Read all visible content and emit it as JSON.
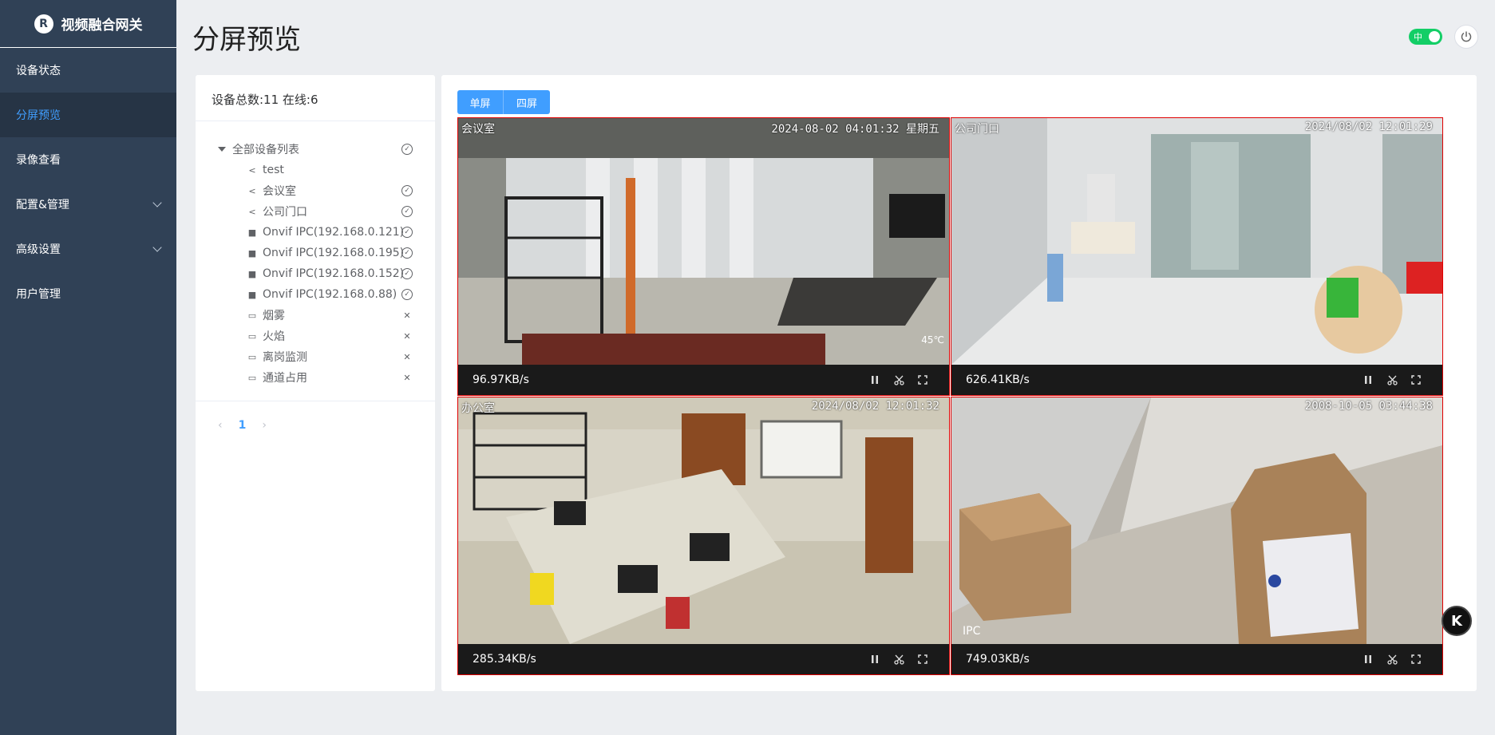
{
  "app": {
    "title": "视频融合网关",
    "logo_glyph": "R"
  },
  "sidebar": {
    "items": [
      {
        "label": "设备状态",
        "active": false,
        "expandable": false
      },
      {
        "label": "分屏预览",
        "active": true,
        "expandable": false
      },
      {
        "label": "录像查看",
        "active": false,
        "expandable": false
      },
      {
        "label": "配置&管理",
        "active": false,
        "expandable": true
      },
      {
        "label": "高级设置",
        "active": false,
        "expandable": true
      },
      {
        "label": "用户管理",
        "active": false,
        "expandable": false
      }
    ]
  },
  "header": {
    "title": "分屏预览",
    "lang_toggle": "中",
    "power_icon": "power-icon"
  },
  "device_panel": {
    "summary": "设备总数:11 在线:6",
    "tree_root": "全部设备列表",
    "tree_root_status": "check",
    "devices": [
      {
        "name": "test",
        "icon": "share-icon",
        "status": "none"
      },
      {
        "name": "会议室",
        "icon": "share-icon",
        "status": "check"
      },
      {
        "name": "公司门口",
        "icon": "share-icon",
        "status": "check"
      },
      {
        "name": "Onvif IPC(192.168.0.121)",
        "icon": "camera-icon",
        "status": "check"
      },
      {
        "name": "Onvif IPC(192.168.0.195)",
        "icon": "camera-icon",
        "status": "check"
      },
      {
        "name": "Onvif IPC(192.168.0.152)",
        "icon": "camera-icon",
        "status": "check"
      },
      {
        "name": "Onvif IPC(192.168.0.88)",
        "icon": "camera-icon",
        "status": "check"
      },
      {
        "name": "烟雾",
        "icon": "video-icon",
        "status": "close"
      },
      {
        "name": "火焰",
        "icon": "video-icon",
        "status": "close"
      },
      {
        "name": "离岗监测",
        "icon": "video-icon",
        "status": "close"
      },
      {
        "name": "通道占用",
        "icon": "video-icon",
        "status": "close"
      }
    ],
    "pagination": {
      "current": "1",
      "prev": "‹",
      "next": "›"
    }
  },
  "preview": {
    "modes": [
      "单屏",
      "四屏"
    ],
    "cells": [
      {
        "name": "会议室",
        "timestamp": "2024-08-02 04:01:32 星期五",
        "extra": "45℃",
        "ipc": "",
        "rate": "96.97KB/s"
      },
      {
        "name": "公司门口",
        "timestamp": "2024/08/02 12:01:29",
        "extra": "",
        "ipc": "",
        "rate": "626.41KB/s"
      },
      {
        "name": "办公室",
        "timestamp": "2024/08/02 12:01:32",
        "extra": "",
        "ipc": "",
        "rate": "285.34KB/s"
      },
      {
        "name": "",
        "timestamp": "2008-10-05 03:44:38",
        "extra": "",
        "ipc": "IPC",
        "rate": "749.03KB/s"
      }
    ]
  },
  "float_badge": "K",
  "colors": {
    "sidebar": "#304156",
    "accent": "#409eff",
    "cell_border": "#e00000",
    "toggle_on": "#13ce66"
  }
}
